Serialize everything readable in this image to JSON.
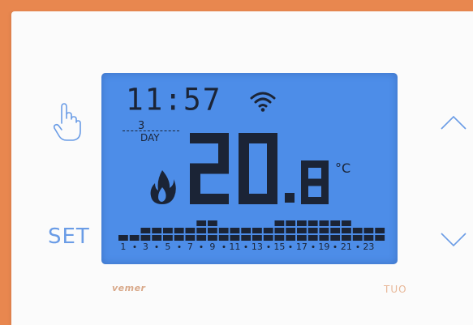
{
  "time": "11:57",
  "day": {
    "number": "3",
    "label": "DAY"
  },
  "temperature": {
    "integer": "20",
    "decimal": "8",
    "unit": "°C"
  },
  "buttons": {
    "set_label": "SET"
  },
  "brand": {
    "left": "vemer",
    "right": "TUO"
  },
  "schedule": {
    "hour_labels": [
      "1",
      "3",
      "5",
      "7",
      "9",
      "11",
      "13",
      "15",
      "17",
      "19",
      "21",
      "23"
    ],
    "levels": [
      1,
      1,
      2,
      2,
      2,
      2,
      2,
      3,
      3,
      2,
      2,
      2,
      2,
      2,
      3,
      3,
      3,
      3,
      3,
      3,
      3,
      2,
      2,
      2
    ]
  },
  "icons": [
    "hand-icon",
    "chevron-up-icon",
    "chevron-down-icon",
    "wifi-icon",
    "flame-icon"
  ],
  "colors": {
    "lcd": "#4d8de8",
    "segment": "#1b2436",
    "accent": "#6a9ce6",
    "frame": "#e8874f"
  }
}
